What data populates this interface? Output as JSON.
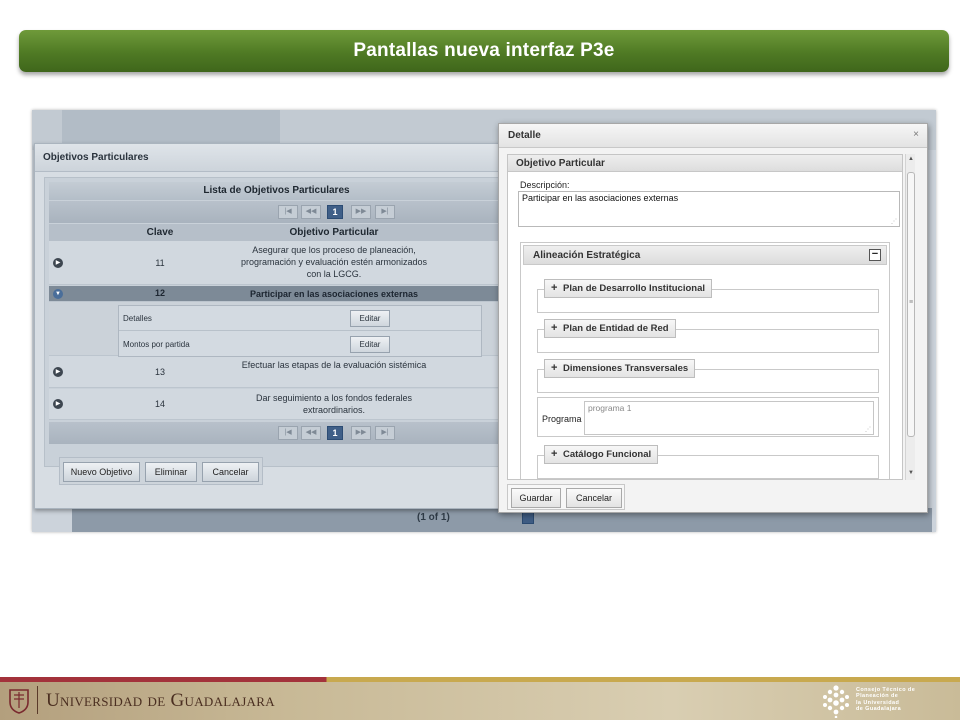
{
  "slide": {
    "title": "Pantallas nueva interfaz P3e"
  },
  "background_app": {
    "pager_text": "(1 of 1)",
    "page_number": "1"
  },
  "left_dialog": {
    "title": "Objetivos Particulares",
    "table_title": "Lista de Objetivos Particulares",
    "pager": {
      "first": "|◀",
      "prev": "◀◀",
      "page": "1",
      "next": "▶▶",
      "last": "▶|"
    },
    "columns": {
      "key": "Clave",
      "objective": "Objetivo Particular"
    },
    "rows": [
      {
        "key": "11",
        "text": "Asegurar que los proceso de planeación, programación y evaluación estén armonizados con la LGCG."
      },
      {
        "key": "12",
        "text": "Participar en las asociaciones externas"
      },
      {
        "key": "13",
        "text": "Efectuar las etapas de la evaluación sistémica"
      },
      {
        "key": "14",
        "text": "Dar seguimiento a los fondos federales extraordinarios."
      }
    ],
    "subtable": [
      {
        "label": "Detalles",
        "button": "Editar"
      },
      {
        "label": "Montos por partida",
        "button": "Editar"
      }
    ],
    "buttons": {
      "new": "Nuevo Objetivo",
      "delete": "Eliminar",
      "cancel": "Cancelar"
    }
  },
  "right_dialog": {
    "title": "Detalle",
    "close_symbol": "×",
    "section_title": "Objetivo Particular",
    "description_label": "Descripción:",
    "description_value": "Participar en las asociaciones externas",
    "alignment_title": "Alineación Estratégica",
    "collapse_symbol": "−",
    "expand_symbol": "+",
    "fieldsets": {
      "plan_institucional": "Plan de Desarrollo Institucional",
      "plan_red": "Plan de Entidad de Red",
      "dimensiones": "Dimensiones Transversales",
      "catalogo": "Catálogo Funcional"
    },
    "programa_label": "Programa",
    "programa_value": "programa 1",
    "buttons": {
      "save": "Guardar",
      "cancel": "Cancelar"
    }
  },
  "footer": {
    "university": "Universidad de Guadalajara",
    "council": [
      "Consejo Técnico de",
      "Planeación de",
      "la Universidad",
      "de Guadalajara"
    ]
  },
  "colors": {
    "banner_green": "#4f7a24",
    "footer_red": "#a3323b",
    "footer_gold": "#c8a94f",
    "selected_row": "#7d8a97"
  }
}
